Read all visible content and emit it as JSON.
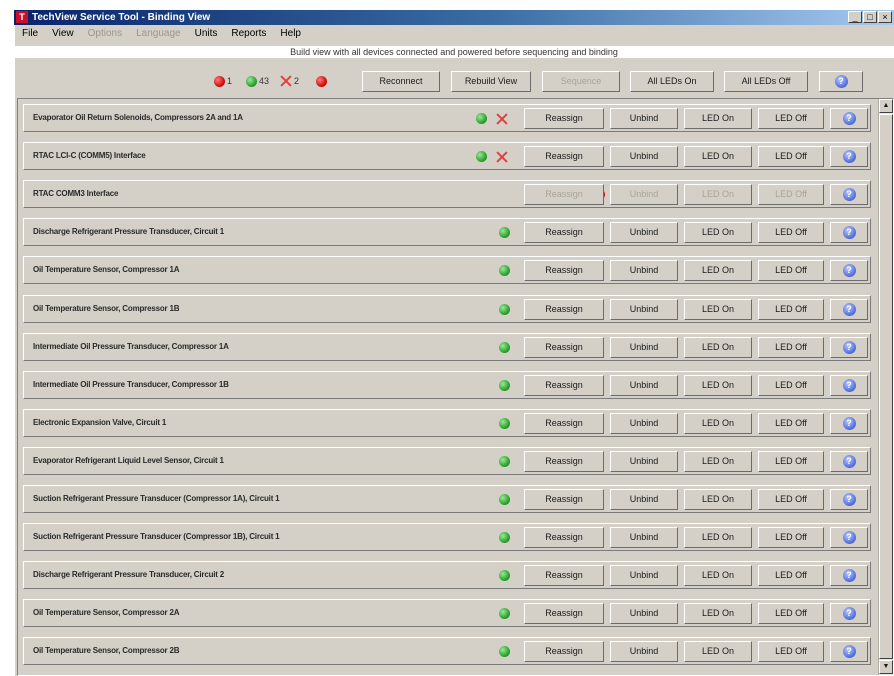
{
  "window": {
    "title": "TechView Service Tool - Binding View"
  },
  "menu": [
    {
      "label": "File",
      "enabled": true
    },
    {
      "label": "View",
      "enabled": true
    },
    {
      "label": "Options",
      "enabled": false
    },
    {
      "label": "Language",
      "enabled": false
    },
    {
      "label": "Units",
      "enabled": true
    },
    {
      "label": "Reports",
      "enabled": true
    },
    {
      "label": "Help",
      "enabled": true
    }
  ],
  "instruction": "Build view with all devices connected and powered before sequencing and binding",
  "status": {
    "red_count": "1",
    "green_count": "43",
    "x_count": "2",
    "red2_count": ""
  },
  "toolbar": {
    "reconnect": "Reconnect",
    "rebuild_view": "Rebuild View",
    "sequence": "Sequence",
    "all_led_on": "All LEDs On",
    "all_led_off": "All LEDs Off",
    "help": "?"
  },
  "row_buttons": {
    "reassign": "Reassign",
    "unbind": "Unbind",
    "led_on": "LED On",
    "led_off": "LED Off",
    "help": "?"
  },
  "devices": [
    {
      "label": "Evaporator Oil Return Solenoids, Compressors 2A and 1A",
      "status": "green",
      "x": true,
      "enabled": true
    },
    {
      "label": "RTAC LCI-C (COMM5) Interface",
      "status": "green",
      "x": true,
      "enabled": true
    },
    {
      "label": "RTAC COMM3 Interface",
      "status": "red",
      "x": false,
      "enabled": false
    },
    {
      "label": "Discharge Refrigerant Pressure Transducer, Circuit 1",
      "status": "green",
      "x": false,
      "enabled": true
    },
    {
      "label": "Oil Temperature Sensor, Compressor 1A",
      "status": "green",
      "x": false,
      "enabled": true
    },
    {
      "label": "Oil Temperature Sensor, Compressor 1B",
      "status": "green",
      "x": false,
      "enabled": true
    },
    {
      "label": "Intermediate Oil Pressure Transducer, Compressor 1A",
      "status": "green",
      "x": false,
      "enabled": true
    },
    {
      "label": "Intermediate Oil Pressure Transducer, Compressor 1B",
      "status": "green",
      "x": false,
      "enabled": true
    },
    {
      "label": "Electronic Expansion Valve, Circuit 1",
      "status": "green",
      "x": false,
      "enabled": true
    },
    {
      "label": "Evaporator Refrigerant Liquid Level Sensor, Circuit 1",
      "status": "green",
      "x": false,
      "enabled": true
    },
    {
      "label": "Suction Refrigerant Pressure Transducer (Compressor 1A), Circuit 1",
      "status": "green",
      "x": false,
      "enabled": true
    },
    {
      "label": "Suction Refrigerant Pressure Transducer (Compressor 1B), Circuit 1",
      "status": "green",
      "x": false,
      "enabled": true
    },
    {
      "label": "Discharge Refrigerant Pressure Transducer, Circuit 2",
      "status": "green",
      "x": false,
      "enabled": true
    },
    {
      "label": "Oil Temperature Sensor, Compressor 2A",
      "status": "green",
      "x": false,
      "enabled": true
    },
    {
      "label": "Oil Temperature Sensor, Compressor 2B",
      "status": "green",
      "x": false,
      "enabled": true
    }
  ]
}
